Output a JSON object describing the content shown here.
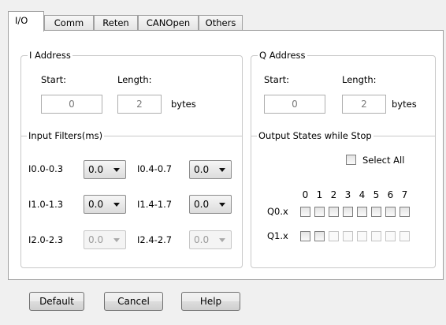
{
  "tabs": [
    {
      "label": "I/O",
      "active": true
    },
    {
      "label": "Comm",
      "active": false
    },
    {
      "label": "Reten",
      "active": false
    },
    {
      "label": "CANOpen",
      "active": false
    },
    {
      "label": "Others",
      "active": false
    }
  ],
  "i_address": {
    "title": "I Address",
    "start_label": "Start:",
    "length_label": "Length:",
    "start_value": "0",
    "length_value": "2",
    "unit": "bytes"
  },
  "q_address": {
    "title": "Q Address",
    "start_label": "Start:",
    "length_label": "Length:",
    "start_value": "0",
    "length_value": "2",
    "unit": "bytes"
  },
  "input_filters": {
    "title": "Input Filters(ms)",
    "rows": [
      {
        "left_label": "I0.0-0.3",
        "left_value": "0.0",
        "right_label": "I0.4-0.7",
        "right_value": "0.0",
        "enabled": true
      },
      {
        "left_label": "I1.0-1.3",
        "left_value": "0.0",
        "right_label": "I1.4-1.7",
        "right_value": "0.0",
        "enabled": true
      },
      {
        "left_label": "I2.0-2.3",
        "left_value": "0.0",
        "right_label": "I2.4-2.7",
        "right_value": "0.0",
        "enabled": false
      }
    ]
  },
  "output_states": {
    "title": "Output States while Stop",
    "select_all_label": "Select All",
    "columns": [
      "0",
      "1",
      "2",
      "3",
      "4",
      "5",
      "6",
      "7"
    ],
    "rows": [
      {
        "label": "Q0.x",
        "checked": [
          false,
          false,
          false,
          false,
          false,
          false,
          false,
          false
        ],
        "enabled": [
          true,
          true,
          true,
          true,
          true,
          true,
          true,
          true
        ]
      },
      {
        "label": "Q1.x",
        "checked": [
          false,
          false,
          false,
          false,
          false,
          false,
          false,
          false
        ],
        "enabled": [
          true,
          true,
          false,
          false,
          false,
          false,
          false,
          false
        ]
      }
    ]
  },
  "buttons": {
    "default": "Default",
    "cancel": "Cancel",
    "help": "Help"
  }
}
